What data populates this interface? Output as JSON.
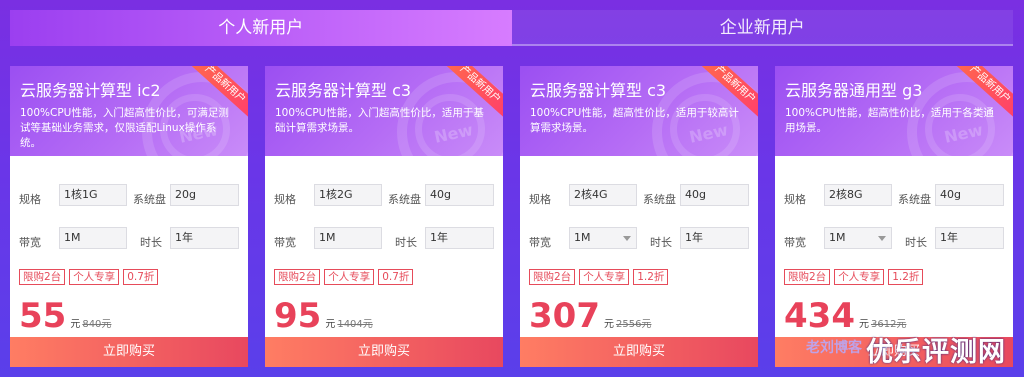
{
  "tabs": [
    {
      "label": "个人新用户",
      "active": true
    },
    {
      "label": "企业新用户",
      "active": false
    }
  ],
  "labels": {
    "spec": "规格",
    "disk": "系统盘",
    "bandwidth": "带宽",
    "duration": "时长"
  },
  "buy_label": "立即购买",
  "unit": "元",
  "ribbon": "产品新用户",
  "cards": [
    {
      "title": "云服务器计算型 ic2",
      "desc": "100%CPU性能，入门超高性价比，可满足测试等基础业务需求，仅限适配Linux操作系统。",
      "spec": "1核1G",
      "disk": "20g",
      "bandwidth": "1M",
      "bandwidth_select": false,
      "duration": "1年",
      "tags": [
        "限购2台",
        "个人专享",
        "0.7折"
      ],
      "price": "55",
      "old_price": "840元"
    },
    {
      "title": "云服务器计算型 c3",
      "desc": "100%CPU性能，入门超高性价比，适用于基础计算需求场景。",
      "spec": "1核2G",
      "disk": "40g",
      "bandwidth": "1M",
      "bandwidth_select": false,
      "duration": "1年",
      "tags": [
        "限购2台",
        "个人专享",
        "0.7折"
      ],
      "price": "95",
      "old_price": "1404元"
    },
    {
      "title": "云服务器计算型 c3",
      "desc": "100%CPU性能，超高性价比，适用于较高计算需求场景。",
      "spec": "2核4G",
      "disk": "40g",
      "bandwidth": "1M",
      "bandwidth_select": true,
      "duration": "1年",
      "tags": [
        "限购2台",
        "个人专享",
        "1.2折"
      ],
      "price": "307",
      "old_price": "2556元"
    },
    {
      "title": "云服务器通用型 g3",
      "desc": "100%CPU性能，超高性价比，适用于各类通用场景。",
      "spec": "2核8G",
      "disk": "40g",
      "bandwidth": "1M",
      "bandwidth_select": true,
      "duration": "1年",
      "tags": [
        "限购2台",
        "个人专享",
        "1.2折"
      ],
      "price": "434",
      "old_price": "3612元"
    }
  ],
  "watermark": {
    "left": "老刘博客",
    "right": "优乐评测网"
  }
}
